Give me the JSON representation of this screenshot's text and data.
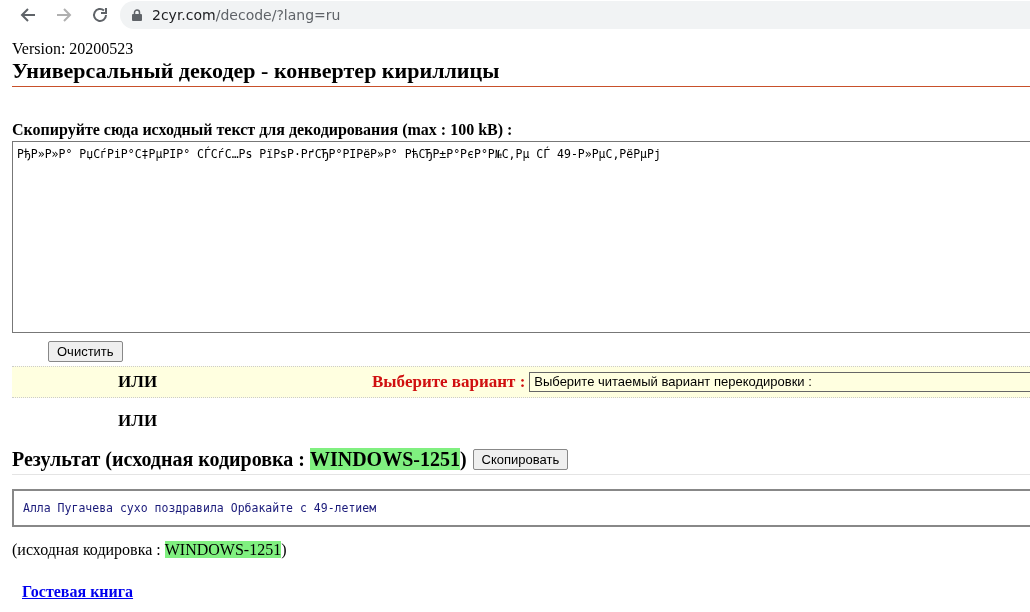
{
  "browser": {
    "url_host": "2cyr.com",
    "url_path": "/decode/?lang=ru"
  },
  "version": "Version: 20200523",
  "title": "Универсальный декодер - конвертер кириллицы",
  "input": {
    "label": "Скопируйте сюда исходный текст для декодирования (max : 100 kB) :",
    "value": "РђР»Р»Р° РџСѓРіР°С‡РµРІР° СЃСѓС…Рѕ РїРѕР·РґСЂР°РІРёР»Р° РћСЂР±Р°РєР°Р№С‚Рµ СЃ 49-Р»РµС‚РёРµРј"
  },
  "clear_button": "Очистить",
  "or_rows": [
    {
      "or": "ИЛИ",
      "prompt": "Выберите вариант :",
      "select": "Выберите читаемый вариант перекодировки :"
    },
    {
      "or": "ИЛИ"
    }
  ],
  "result": {
    "label": "Результат (исходная кодировка : ",
    "encoding": "WINDOWS-1251",
    "close": ")",
    "copy_button": "Скопировать",
    "text": "Алла Пугачева сухо поздравила Орбакайте с 49-летием"
  },
  "footer_encoding": {
    "label": "(исходная кодировка : ",
    "encoding": "WINDOWS-1251",
    "close": ")"
  },
  "guestbook_link": "Гостевая книга"
}
